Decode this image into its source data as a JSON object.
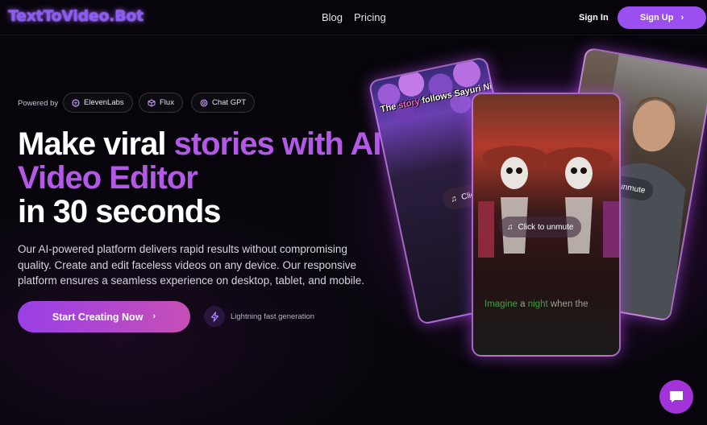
{
  "header": {
    "logo": "TextToVideo.Bot",
    "nav": [
      {
        "label": "Blog"
      },
      {
        "label": "Pricing"
      }
    ],
    "signin_label": "Sign In",
    "signup_label": "Sign Up"
  },
  "hero": {
    "powered_by_label": "Powered by",
    "badges": [
      {
        "label": "ElevenLabs",
        "icon": "elevenlabs-icon"
      },
      {
        "label": "Flux",
        "icon": "cube-icon"
      },
      {
        "label": "Chat GPT",
        "icon": "openai-icon"
      }
    ],
    "headline": {
      "part1": "Make viral ",
      "part2": "stories with AI",
      "line2": "Video Editor",
      "line3": "in 30 seconds"
    },
    "description": "Our AI-powered platform delivers rapid results without compromising quality. Create and edit faceless videos on any device. Our responsive platform ensures a seamless experience on desktop, tablet, and mobile.",
    "cta_label": "Start Creating Now",
    "feature_label": "Lightning fast generation"
  },
  "cards": {
    "left": {
      "caption_pre": "The ",
      "caption_hl": "story",
      "caption_post": " follows Sayuri Nitta",
      "unmute": "Clic"
    },
    "center": {
      "unmute": "Click to unmute",
      "caption_a": "Imagine",
      "caption_b": " a ",
      "caption_c": "night",
      "caption_d": " when the"
    },
    "right": {
      "unmute": "unmute"
    }
  },
  "colors": {
    "accent": "#9b4ff0",
    "headline_accent": "#b458e8",
    "background": "#07050b"
  }
}
